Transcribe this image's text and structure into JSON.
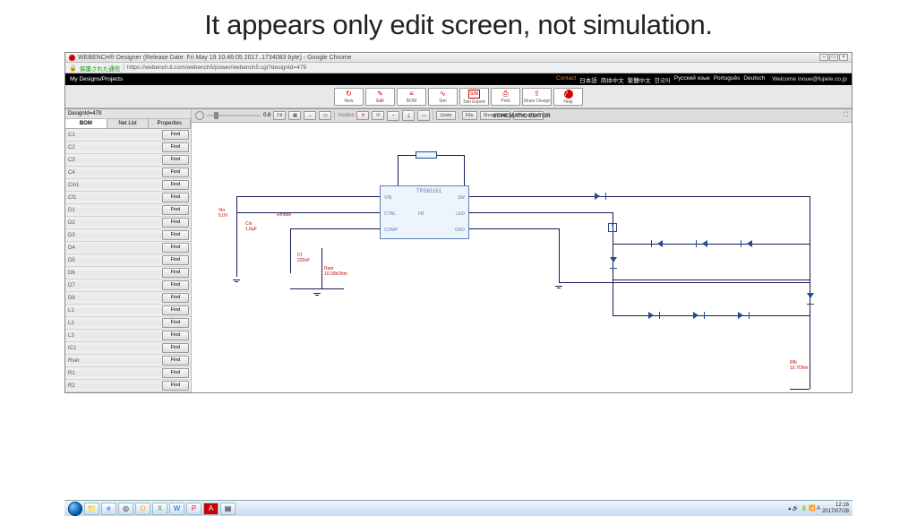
{
  "slide_title": "It appears only edit screen, not simulation.",
  "window_title": "WEBENCH® Designer (Release Date: Fri May 19 10:46:05 2017..1734083 byte) - Google Chrome",
  "address_bar": {
    "secure_label": "保護された通信",
    "url": "https://webench.ti.com/webench5/power/webench5.cgi?designId=479"
  },
  "blackbar": {
    "my_designs": "My Designs/Projects",
    "contact": "Contact",
    "langs": [
      "日本語",
      "简体中文",
      "繁體中文",
      "한국어",
      "Pусский язык",
      "Português",
      "Deutsch"
    ],
    "welcome": "Welcome  inoue@fujiele.co.jp"
  },
  "main_toolbar": [
    {
      "label": "New",
      "icon": "↻"
    },
    {
      "label": "Edit",
      "icon": "✎"
    },
    {
      "label": "BOM",
      "icon": "≡"
    },
    {
      "label": "Sim",
      "icon": "∿"
    },
    {
      "label": "Sim Export",
      "icon": "SIM"
    },
    {
      "label": "Print",
      "icon": "⎙"
    },
    {
      "label": "Share Design",
      "icon": "⇪"
    },
    {
      "label": "Help",
      "icon": "?"
    }
  ],
  "design_id_label": "DesignId=479",
  "sidebar_tabs": [
    "BOM",
    "Net List",
    "Properties"
  ],
  "bom_items": [
    "C1",
    "C2",
    "C3",
    "C4",
    "Cin1",
    "Cf1",
    "D1",
    "D2",
    "D3",
    "D4",
    "D5",
    "D6",
    "D7",
    "D8",
    "L1",
    "L2",
    "L3",
    "IC1",
    "Rset",
    "R1",
    "R2"
  ],
  "find_label": "Find",
  "editor_header": {
    "title": "SCHEMATIC EDITOR",
    "zoom_value": "0.6",
    "fit_label": "Fit",
    "undo_label": "Undo",
    "file_label": "File",
    "showhide_label": "Show/Hide",
    "placepart_label": "Place Part"
  },
  "chip": {
    "name": "TPS61161",
    "pins": {
      "vin": "VIN",
      "ctrl": "CTRL",
      "comp": "COMP",
      "sw": "SW",
      "led": "LED",
      "fb": "FB",
      "gnd": "GND"
    }
  },
  "annot": {
    "vin": "Vin\n5.0V",
    "cin": "Cin\n1.0µF",
    "rmode": "Rmode",
    "cf": "Cf\n220nF",
    "rset": "Rset\n10.00kOhm",
    "rfb": "Rfb\n10.7Ohm"
  },
  "taskbar": {
    "time": "12:16",
    "date": "2017/07/28"
  }
}
